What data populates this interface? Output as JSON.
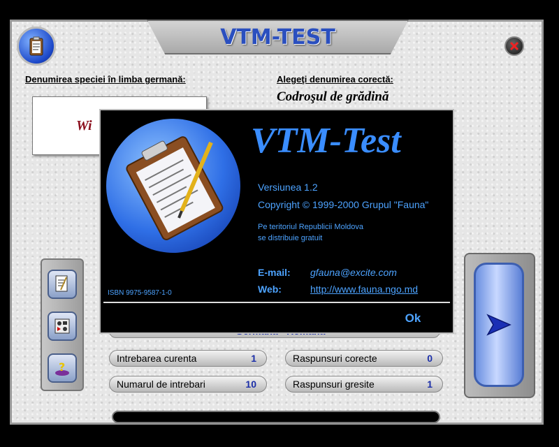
{
  "app": {
    "title_part1": "VTM-",
    "title_part2": "TEST"
  },
  "labels": {
    "question_label": "Denumirea speciei în limba germană:",
    "answer_label": "Alegeţi denumirea corectă:",
    "answer_title": "Codroşul de grădină",
    "question_word": "Wi",
    "hidden_strip": "Germana - Romana"
  },
  "stats": {
    "current_question_label": "Intrebarea curenta",
    "current_question_value": "1",
    "total_questions_label": "Numarul de intrebari",
    "total_questions_value": "10",
    "correct_label": "Raspunsuri corecte",
    "correct_value": "0",
    "wrong_label": "Raspunsuri gresite",
    "wrong_value": "1"
  },
  "about": {
    "title": "VTM-Test",
    "version": "Versiunea 1.2",
    "copyright": "Copyright © 1999-2000 Grupul \"Fauna\"",
    "dist_line1": "Pe teritoriul Republicii Moldova",
    "dist_line2": "se distribuie gratuit",
    "email_label": "E-mail:",
    "email_value": "gfauna@excite.com",
    "web_label": "Web:",
    "web_value": "http://www.fauna.ngo.md",
    "isbn": "ISBN 9975-9587-1-0",
    "ok_label": "Ok"
  },
  "colors": {
    "accent": "#4da3ff",
    "title_blue": "#2a4fbf",
    "answer_red": "#8b0e1c"
  },
  "icons": [
    "clipboard-icon",
    "close-icon",
    "notes-icon",
    "media-icon",
    "help-icon",
    "next-arrow-icon"
  ]
}
